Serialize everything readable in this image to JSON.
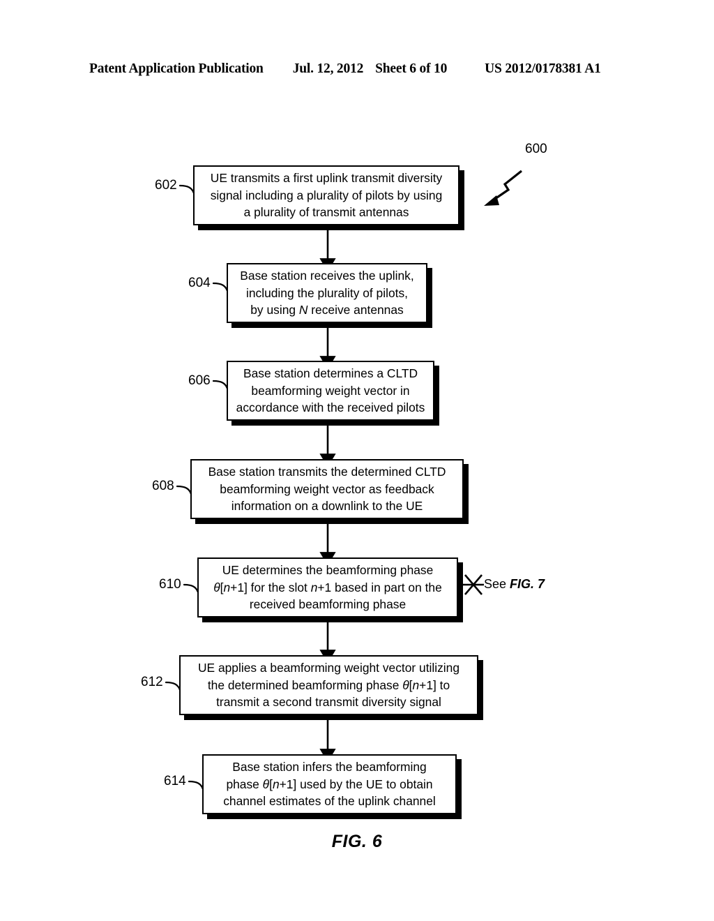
{
  "header": {
    "publication": "Patent Application Publication",
    "date": "Jul. 12, 2012",
    "sheet": "Sheet 6 of 10",
    "patent_number": "US 2012/0178381 A1"
  },
  "figure": {
    "caption": "FIG. 6",
    "diagram_ref": "600",
    "side_note_see": "See",
    "side_note_fig": "FIG. 7",
    "star_marker_icon": "asterisk-marker-icon"
  },
  "steps": [
    {
      "ref": "602",
      "lines": [
        "UE transmits a first uplink transmit diversity",
        "signal including a plurality of pilots by using",
        "a plurality of transmit antennas"
      ],
      "text": "UE transmits a first uplink transmit diversity signal including a plurality of pilots by using a plurality of transmit antennas"
    },
    {
      "ref": "604",
      "lines": [
        "Base station receives the uplink,",
        "including the plurality of pilots,",
        "by using N receive antennas"
      ],
      "text": "Base station receives the uplink, including the plurality of pilots, by using N receive antennas"
    },
    {
      "ref": "606",
      "lines": [
        "Base station determines a CLTD",
        "beamforming weight vector in",
        "accordance with the received pilots"
      ],
      "text": "Base station determines a CLTD beamforming weight vector in accordance with the received pilots"
    },
    {
      "ref": "608",
      "lines": [
        "Base station transmits the determined CLTD",
        "beamforming weight vector as feedback",
        "information on a downlink to the UE"
      ],
      "text": "Base station transmits the determined CLTD beamforming weight vector as feedback information on a downlink to the UE"
    },
    {
      "ref": "610",
      "lines": [
        "UE determines the beamforming phase",
        "θ[n+1] for the slot n+1 based in part on the",
        "received beamforming phase"
      ],
      "text": "UE determines the beamforming phase θ[n+1] for the slot n+1 based in part on the received beamforming phase"
    },
    {
      "ref": "612",
      "lines": [
        "UE applies a beamforming weight vector utilizing",
        "the determined beamforming phase θ[n+1] to",
        "transmit a second transmit diversity signal"
      ],
      "text": "UE applies a beamforming weight vector utilizing the determined beamforming phase θ[n+1] to transmit a second transmit diversity signal"
    },
    {
      "ref": "614",
      "lines": [
        "Base station infers the beamforming",
        "phase θ[n+1] used by the UE to obtain",
        "channel estimates of the uplink channel"
      ],
      "text": "Base station infers the beamforming phase θ[n+1] used by the UE to obtain channel estimates of the uplink channel"
    }
  ],
  "colors": {
    "ink": "#000000",
    "paper": "#ffffff"
  }
}
